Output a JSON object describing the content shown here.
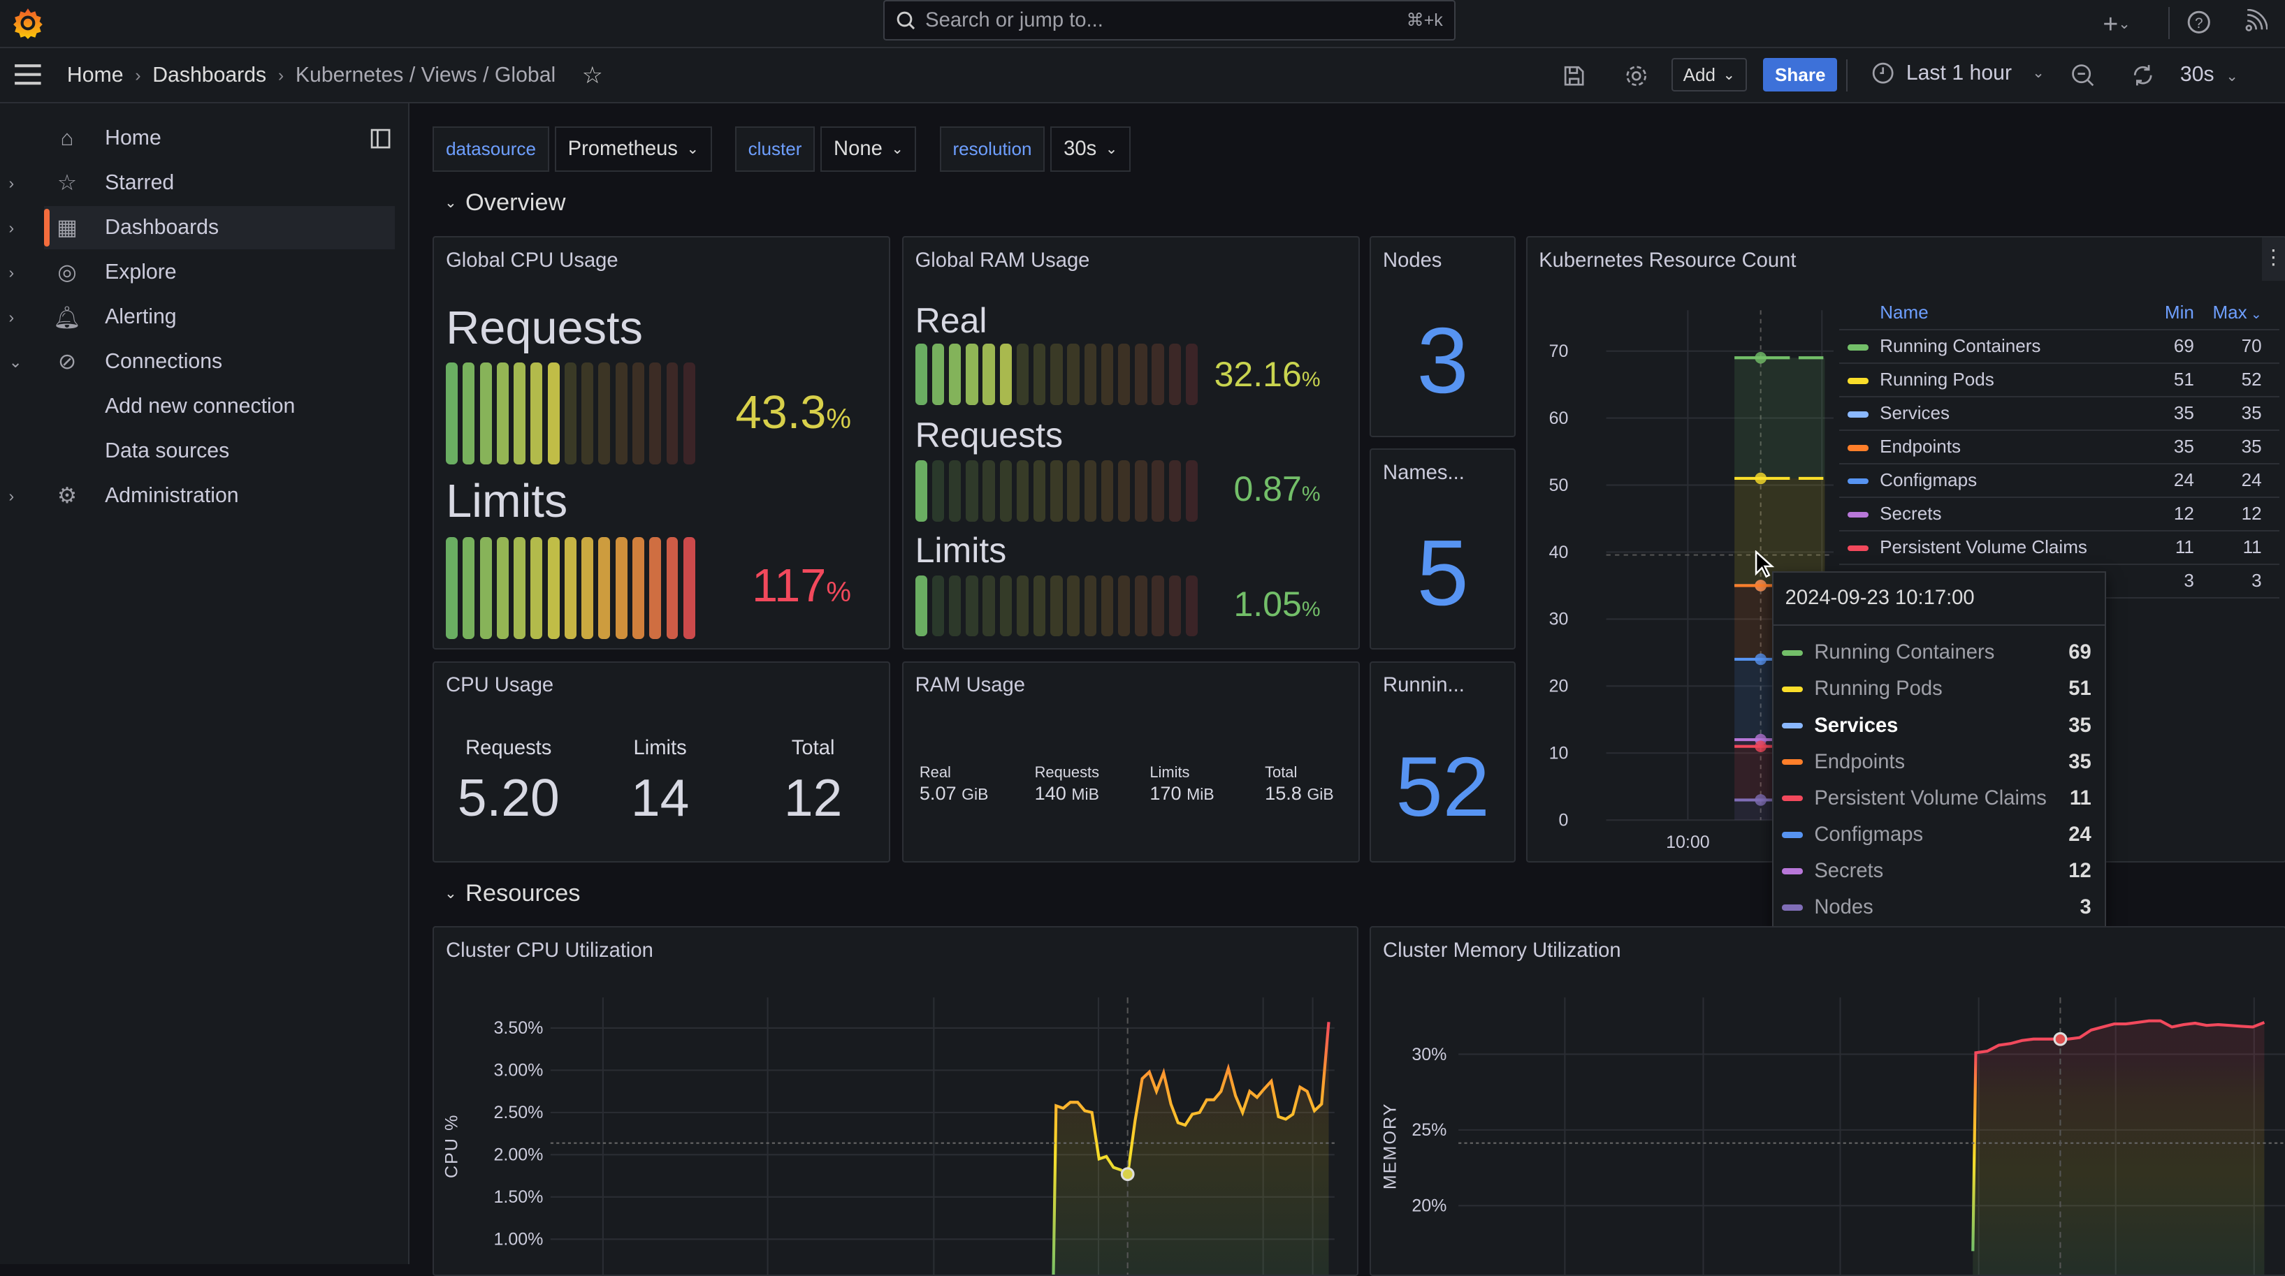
{
  "topbar": {
    "search_placeholder": "Search or jump to...",
    "search_shortcut": "⌘+k"
  },
  "breadcrumb": [
    "Home",
    "Dashboards",
    "Kubernetes / Views / Global"
  ],
  "toolbar": {
    "add_label": "Add",
    "share_label": "Share",
    "time_range": "Last 1 hour",
    "refresh_interval": "30s"
  },
  "sidebar": {
    "items": [
      {
        "label": "Home",
        "icon": "home-icon"
      },
      {
        "label": "Starred",
        "icon": "star-icon"
      },
      {
        "label": "Dashboards",
        "icon": "dashboards-icon",
        "active": true
      },
      {
        "label": "Explore",
        "icon": "compass-icon"
      },
      {
        "label": "Alerting",
        "icon": "bell-icon"
      },
      {
        "label": "Connections",
        "icon": "connections-icon",
        "expanded": true
      },
      {
        "label": "Add new connection"
      },
      {
        "label": "Data sources"
      },
      {
        "label": "Administration",
        "icon": "gear-icon"
      }
    ]
  },
  "variables": [
    {
      "label": "datasource",
      "value": "Prometheus"
    },
    {
      "label": "cluster",
      "value": "None"
    },
    {
      "label": "resolution",
      "value": "30s"
    }
  ],
  "sections": {
    "overview": "Overview",
    "resources": "Resources"
  },
  "colors": {
    "accent": "#3d71d9",
    "stat_blue": "#5794f2",
    "green": "#73bf69",
    "yellow": "#fade2a",
    "red": "#f2495c",
    "orange": "#ff9830"
  },
  "cpu_gauge": {
    "title": "Global CPU Usage",
    "items": [
      {
        "label": "Requests",
        "value": "43.3",
        "unit": "%",
        "percent": 43.3,
        "color": "#d8d04a"
      },
      {
        "label": "Limits",
        "value": "117",
        "unit": "%",
        "percent": 117,
        "color": "#f2495c"
      }
    ]
  },
  "ram_gauge": {
    "title": "Global RAM Usage",
    "items": [
      {
        "label": "Real",
        "value": "32.16",
        "unit": "%",
        "percent": 32.16,
        "color": "#c9d44f"
      },
      {
        "label": "Requests",
        "value": "0.87",
        "unit": "%",
        "percent": 0.87,
        "color": "#73bf69"
      },
      {
        "label": "Limits",
        "value": "1.05",
        "unit": "%",
        "percent": 1.05,
        "color": "#73bf69"
      }
    ]
  },
  "nodes": {
    "title": "Nodes",
    "value": "3"
  },
  "namespaces": {
    "title": "Names...",
    "value": "5"
  },
  "running": {
    "title": "Runnin...",
    "value": "52"
  },
  "cpu_usage": {
    "title": "CPU Usage",
    "items": [
      {
        "label": "Requests",
        "value": "5.20"
      },
      {
        "label": "Limits",
        "value": "14"
      },
      {
        "label": "Total",
        "value": "12"
      }
    ]
  },
  "ram_usage": {
    "title": "RAM Usage",
    "items": [
      {
        "label": "Real",
        "value": "5.07",
        "unit": "GiB"
      },
      {
        "label": "Requests",
        "value": "140",
        "unit": "MiB"
      },
      {
        "label": "Limits",
        "value": "170",
        "unit": "MiB"
      },
      {
        "label": "Total",
        "value": "15.8",
        "unit": "GiB"
      }
    ]
  },
  "resource_count": {
    "title": "Kubernetes Resource Count",
    "legend_headers": {
      "name": "Name",
      "min": "Min",
      "max": "Max"
    },
    "tooltip": {
      "time": "2024-09-23 10:17:00",
      "rows": [
        {
          "name": "Running Containers",
          "value": "69",
          "color": "#73bf69"
        },
        {
          "name": "Running Pods",
          "value": "51",
          "color": "#fade2a"
        },
        {
          "name": "Services",
          "value": "35",
          "color": "#8ab8ff",
          "highlight": true
        },
        {
          "name": "Endpoints",
          "value": "35",
          "color": "#ff7f2a"
        },
        {
          "name": "Persistent Volume Claims",
          "value": "11",
          "color": "#f2495c"
        },
        {
          "name": "Configmaps",
          "value": "24",
          "color": "#5794f2"
        },
        {
          "name": "Secrets",
          "value": "12",
          "color": "#b877d9"
        },
        {
          "name": "Nodes",
          "value": "3",
          "color": "#806eb7"
        }
      ]
    }
  },
  "chart_data": [
    {
      "type": "line",
      "title": "Kubernetes Resource Count",
      "x_ticks": [
        "10:00"
      ],
      "ylim": [
        0,
        70
      ],
      "y_ticks": [
        0,
        10,
        20,
        30,
        40,
        50,
        60,
        70
      ],
      "legend": "right-table",
      "series": [
        {
          "name": "Running Containers",
          "min": 69,
          "max": 70,
          "value": 69,
          "color": "#73bf69"
        },
        {
          "name": "Running Pods",
          "min": 51,
          "max": 52,
          "value": 51,
          "color": "#fade2a"
        },
        {
          "name": "Services",
          "min": 35,
          "max": 35,
          "value": 35,
          "color": "#8ab8ff"
        },
        {
          "name": "Endpoints",
          "min": 35,
          "max": 35,
          "value": 35,
          "color": "#ff7f2a"
        },
        {
          "name": "Configmaps",
          "min": 24,
          "max": 24,
          "value": 24,
          "color": "#5794f2"
        },
        {
          "name": "Secrets",
          "min": 12,
          "max": 12,
          "value": 12,
          "color": "#b877d9"
        },
        {
          "name": "Persistent Volume Claims",
          "min": 11,
          "max": 11,
          "value": 11,
          "color": "#f2495c"
        },
        {
          "name": "Nodes",
          "min": 3,
          "max": 3,
          "value": 3,
          "color": "#806eb7"
        }
      ]
    },
    {
      "type": "area",
      "title": "Cluster CPU Utilization",
      "ylabel": "CPU %",
      "y_ticks": [
        "1.00%",
        "1.50%",
        "2.00%",
        "2.50%",
        "3.00%",
        "3.50%"
      ],
      "grid": true,
      "values": [
        0.5,
        2.58,
        2.55,
        2.62,
        2.62,
        2.52,
        2.5,
        1.95,
        1.98,
        1.85,
        1.82,
        1.77,
        2.4,
        2.9,
        2.98,
        2.75,
        2.97,
        2.6,
        2.38,
        2.35,
        2.48,
        2.5,
        2.65,
        2.65,
        2.75,
        3.02,
        2.7,
        2.5,
        2.75,
        2.68,
        2.78,
        2.87,
        2.45,
        2.42,
        2.48,
        2.8,
        2.75,
        2.52,
        2.6,
        3.57
      ]
    },
    {
      "type": "area",
      "title": "Cluster Memory Utilization",
      "ylabel": "MEMORY",
      "y_ticks": [
        "20%",
        "25%",
        "30%"
      ],
      "grid": true,
      "values": [
        17,
        30.1,
        30.2,
        30.6,
        30.7,
        30.9,
        31.0,
        31.0,
        31.0,
        31.0,
        31.1,
        31.6,
        31.8,
        32.0,
        32.0,
        32.1,
        32.2,
        32.2,
        31.8,
        31.95,
        32.05,
        31.9,
        31.95,
        31.9,
        31.85,
        31.8,
        32.1
      ]
    }
  ]
}
